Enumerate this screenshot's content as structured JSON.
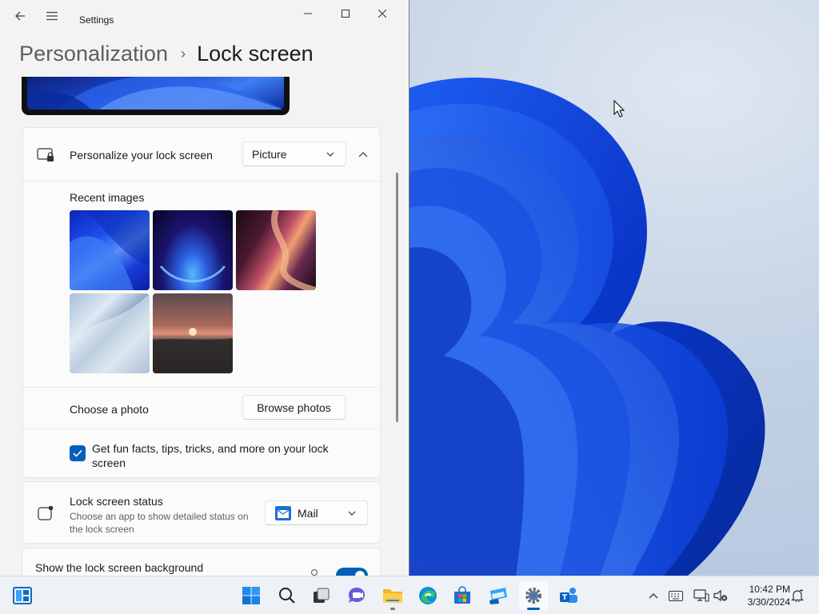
{
  "window": {
    "app_title": "Settings",
    "breadcrumb_parent": "Personalization",
    "breadcrumb_separator": "›",
    "breadcrumb_current": "Lock screen"
  },
  "personalize": {
    "label": "Personalize your lock screen",
    "dropdown_value": "Picture",
    "recent_images_label": "Recent images",
    "recent_images": [
      "blue-bloom",
      "blue-glow",
      "red-ribbon",
      "silver-flow",
      "sunset-lake"
    ],
    "choose_photo_label": "Choose a photo",
    "browse_button": "Browse photos",
    "fun_facts_label": "Get fun facts, tips, tricks, and more on your lock screen",
    "fun_facts_checked": true
  },
  "status": {
    "label": "Lock screen status",
    "description": "Choose an app to show detailed status on the lock screen",
    "dropdown_value": "Mail"
  },
  "background": {
    "label": "Show the lock screen background",
    "toggle_on": true
  },
  "taskbar": {
    "apps": [
      "widgets",
      "start",
      "search",
      "task-view",
      "chat",
      "file-explorer",
      "edge",
      "store",
      "azure-data-studio",
      "settings",
      "microsoft-teams"
    ],
    "active_app": "settings",
    "clock_time": "10:42 PM",
    "clock_date": "3/30/2024"
  },
  "colors": {
    "accent": "#005fb8",
    "window_bg": "#f3f3f3",
    "card_bg": "#fbfbfb"
  }
}
